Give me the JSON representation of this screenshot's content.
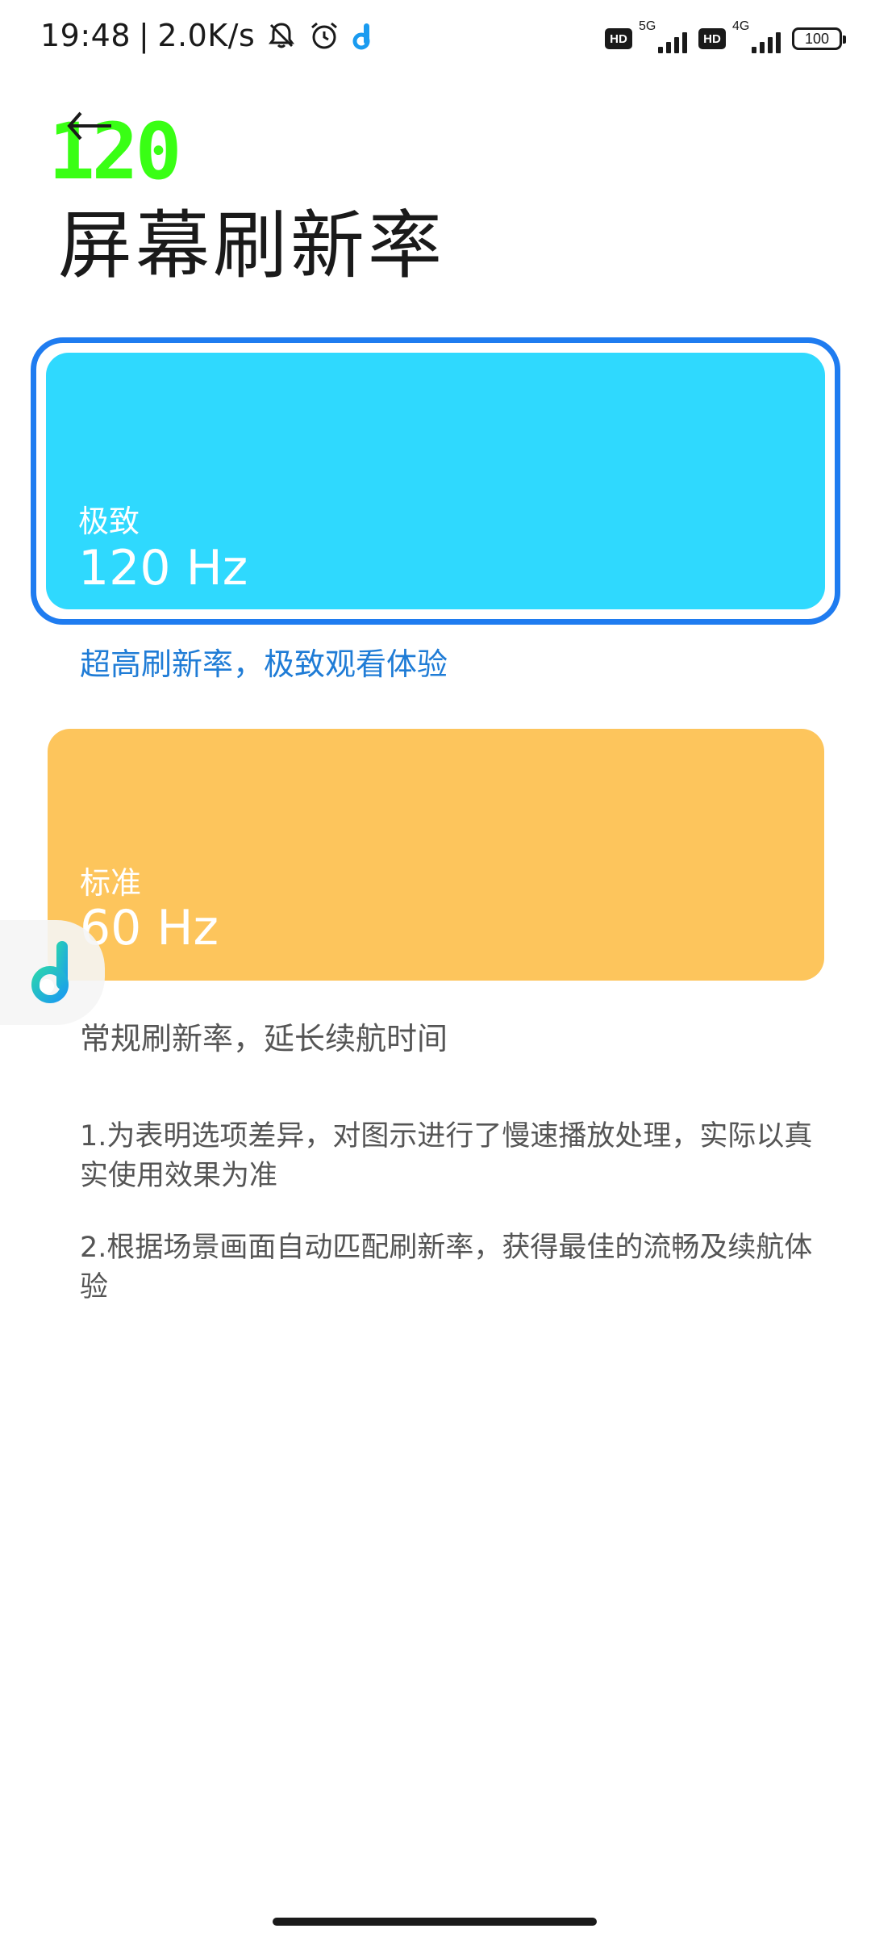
{
  "status_bar": {
    "time": "19:48",
    "separator": "|",
    "speed": "2.0K/s",
    "network_1": "5G",
    "network_2": "4G",
    "hd": "HD",
    "battery": "100",
    "icons": [
      "bell-off-icon",
      "alarm-icon",
      "app-notification-icon",
      "signal-icon",
      "battery-icon"
    ]
  },
  "overlay": {
    "fps": "120"
  },
  "header": {
    "back_icon": "back-arrow-icon",
    "title": "屏幕刷新率"
  },
  "options": [
    {
      "label": "极致",
      "rate": "120 Hz",
      "description": "超高刷新率，极致观看体验",
      "selected": true,
      "color": "#2fd9fe"
    },
    {
      "label": "标准",
      "rate": "60 Hz",
      "description": "常规刷新率，延长续航时间",
      "selected": false,
      "color": "#fdc55c"
    }
  ],
  "notes": [
    "1.为表明选项差异，对图示进行了慢速播放处理，实际以真实使用效果为准",
    "2.根据场景画面自动匹配刷新率，获得最佳的流畅及续航体验"
  ],
  "colors": {
    "accent": "#1f7cf0",
    "selected_text": "#1f7cd6",
    "fps_overlay": "#39ff14"
  }
}
